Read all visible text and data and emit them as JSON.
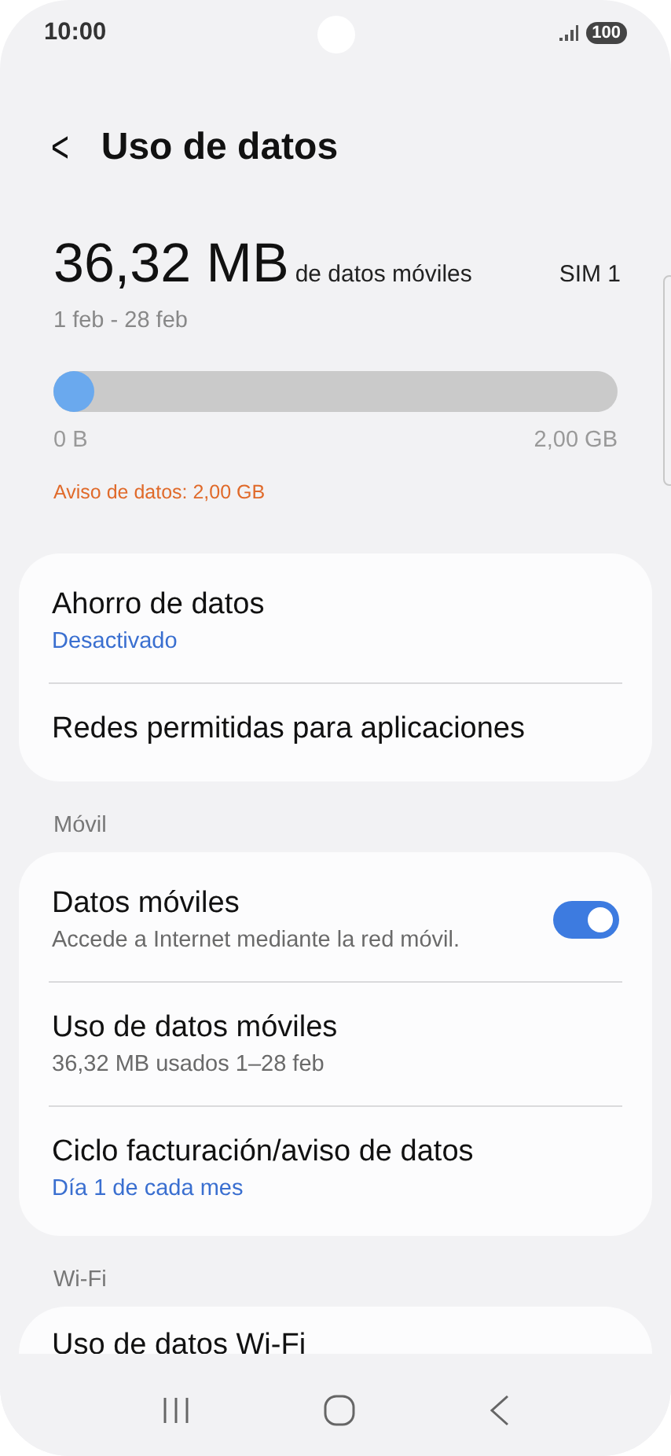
{
  "status_bar": {
    "time": "10:00",
    "battery": "100"
  },
  "header": {
    "back": "<",
    "title": "Uso de datos"
  },
  "usage": {
    "amount": "36,32 MB",
    "unit_label": "de datos móviles",
    "sim": "SIM 1",
    "period": "1 feb - 28 feb",
    "level": 0.018,
    "min_label": "0 B",
    "max_label": "2,00 GB",
    "warning": "Aviso de datos: 2,00 GB"
  },
  "sections": [
    {
      "items": [
        {
          "title": "Ahorro de datos",
          "subtitle": "Desactivado",
          "subtitle_accent": true
        },
        {
          "title": "Redes permitidas para aplicaciones"
        }
      ]
    },
    {
      "heading": "Móvil",
      "items": [
        {
          "title": "Datos móviles",
          "subtitle": "Accede a Internet mediante la red móvil.",
          "subtitle_accent": false,
          "toggle": {
            "on": true
          }
        },
        {
          "title": "Uso de datos móviles",
          "subtitle": "36,32 MB usados 1–28 feb",
          "subtitle_accent": false
        },
        {
          "title": "Ciclo facturación/aviso de datos",
          "subtitle": "Día 1 de cada mes",
          "subtitle_accent": true
        }
      ]
    },
    {
      "heading": "Wi-Fi",
      "cut": true,
      "items": [
        {
          "title": "Uso de datos Wi-Fi"
        }
      ]
    }
  ]
}
